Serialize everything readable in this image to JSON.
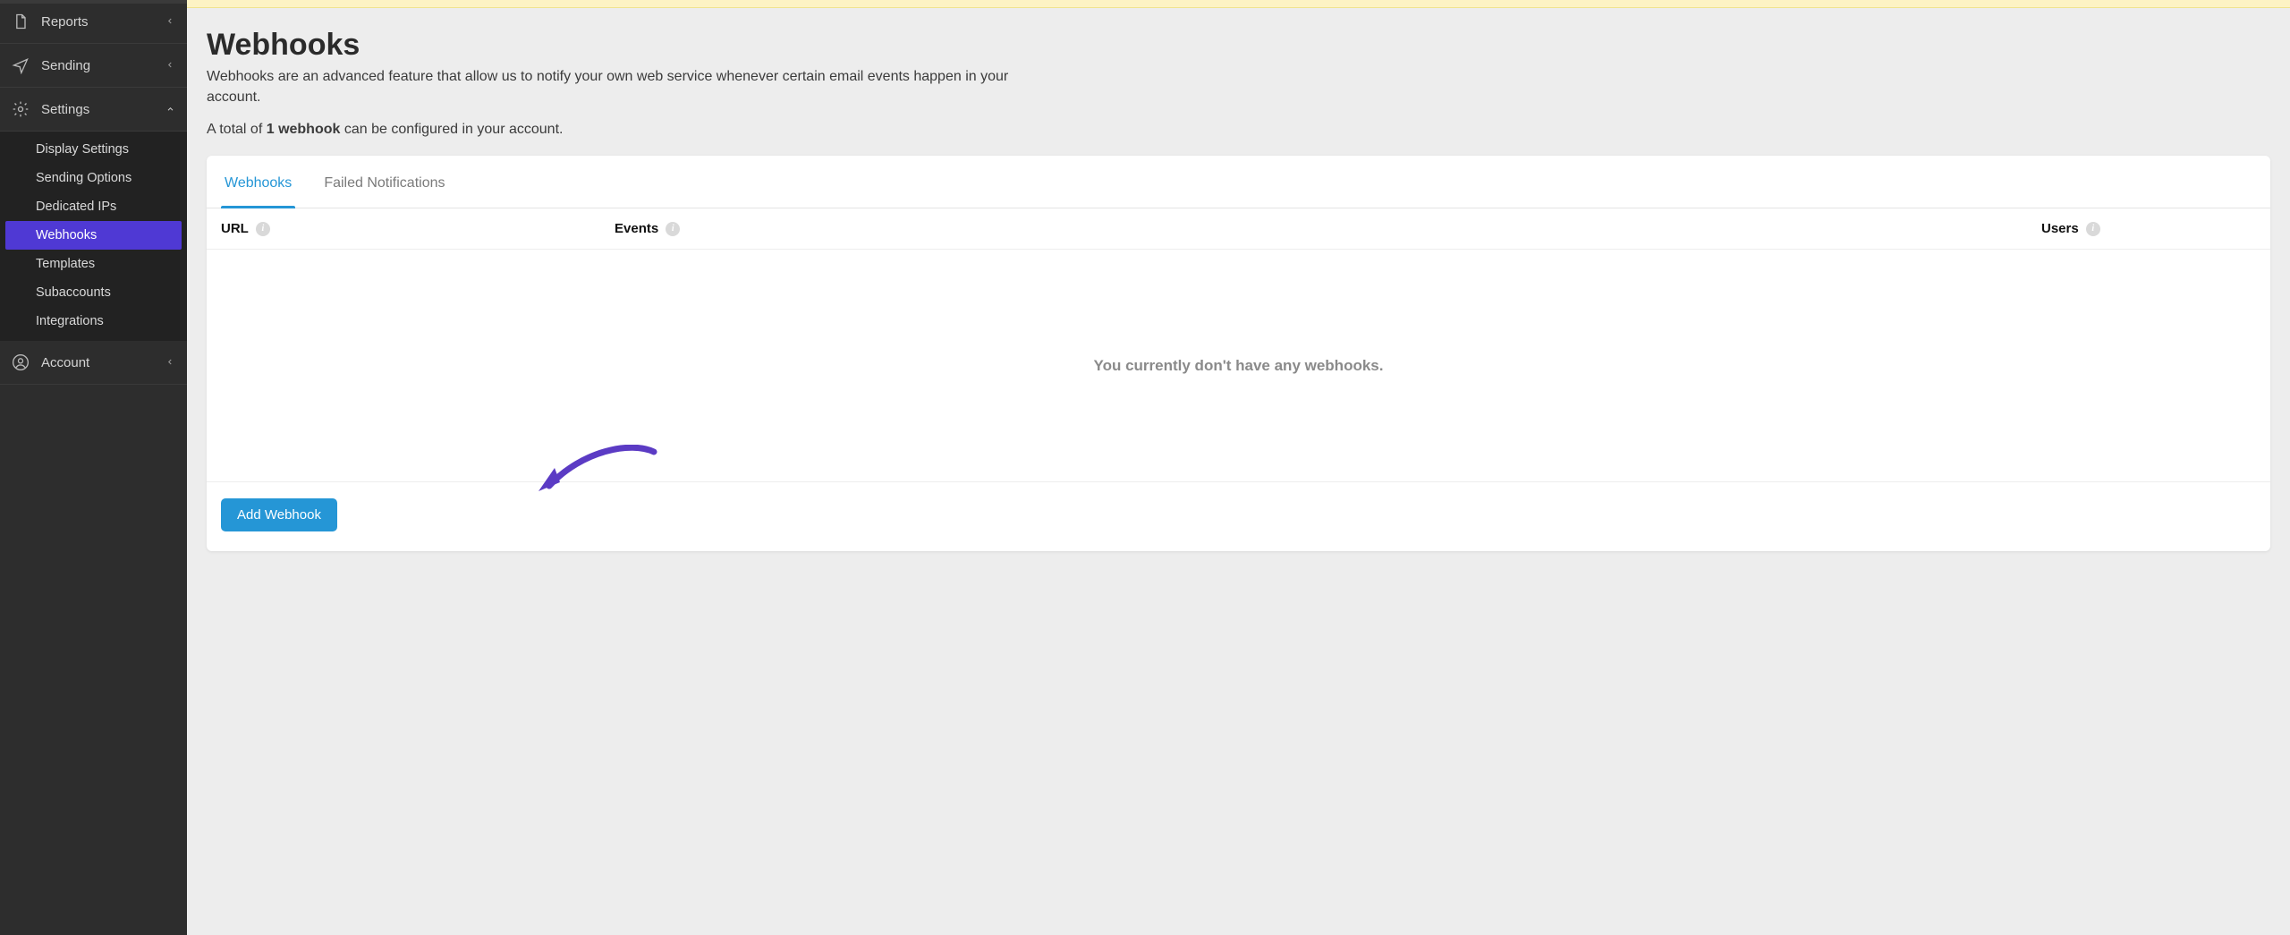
{
  "sidebar": {
    "items": [
      {
        "label": "Reports",
        "hasChev": true,
        "expanded": false
      },
      {
        "label": "Sending",
        "hasChev": true,
        "expanded": false
      },
      {
        "label": "Settings",
        "hasChev": true,
        "expanded": true,
        "children": [
          {
            "label": "Display Settings"
          },
          {
            "label": "Sending Options"
          },
          {
            "label": "Dedicated IPs"
          },
          {
            "label": "Webhooks",
            "active": true
          },
          {
            "label": "Templates"
          },
          {
            "label": "Subaccounts"
          },
          {
            "label": "Integrations"
          }
        ]
      },
      {
        "label": "Account",
        "hasChev": true,
        "expanded": false
      }
    ]
  },
  "page": {
    "title": "Webhooks",
    "description": "Webhooks are an advanced feature that allow us to notify your own web service whenever certain email events happen in your account.",
    "quota_prefix": "A total of ",
    "quota_bold": "1 webhook",
    "quota_suffix": " can be configured in your account."
  },
  "tabs": [
    {
      "label": "Webhooks",
      "active": true
    },
    {
      "label": "Failed Notifications",
      "active": false
    }
  ],
  "table": {
    "columns": {
      "url": "URL",
      "events": "Events",
      "users": "Users"
    },
    "empty_message": "You currently don't have any webhooks."
  },
  "actions": {
    "add_webhook": "Add Webhook"
  },
  "annotation_arrow_color": "#5b3bc4"
}
